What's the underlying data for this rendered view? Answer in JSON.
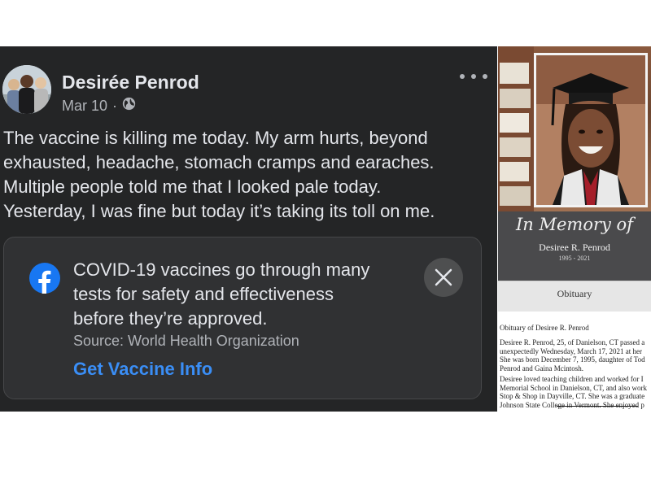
{
  "post": {
    "author_name": "Desirée Penrod",
    "date": "Mar 10",
    "separator": "·",
    "text_lines": [
      "The vaccine is killing me today. My arm hurts, beyond",
      "exhausted, headache, stomach cramps and earaches.",
      "Multiple people told me that I looked pale today.",
      "Yesterday, I was fine but today it’s taking its toll on me."
    ]
  },
  "info_card": {
    "message_lines": [
      "COVID-19 vaccines go through many",
      "tests for safety and effectiveness",
      "before they’re approved."
    ],
    "source": "Source: World Health Organization",
    "link_label": "Get Vaccine Info"
  },
  "memorial": {
    "heading": "In Memory of",
    "name": "Desiree R. Penrod",
    "years": "1995 - 2021",
    "tab_label": "Obituary",
    "obituary_title": "Obituary of Desiree R. Penrod",
    "paragraph1": [
      "Desiree R. Penrod, 25, of Danielson, CT passed a",
      "unexpectedly Wednesday, March 17, 2021 at her",
      "She was born December 7, 1995, daughter of Tod",
      "Penrod and Gaina Mcintosh."
    ],
    "paragraph2": [
      "Desiree loved teaching children and worked for I",
      "Memorial School in Danielson, CT, and also work",
      "Stop & Shop in Dayville, CT.  She was a graduate",
      "Johnson State College in Vermont. She enjoyed p"
    ]
  },
  "colors": {
    "post_background": "#242526",
    "card_background": "#303133",
    "facebook_blue": "#1877f2",
    "link_blue": "#3a8ef6",
    "primary_text": "#e4e6eb",
    "secondary_text": "#b0b3b8"
  },
  "icons": {
    "globe": "globe-icon",
    "more": "more-options-icon",
    "facebook": "facebook-logo-icon",
    "close": "close-icon"
  }
}
